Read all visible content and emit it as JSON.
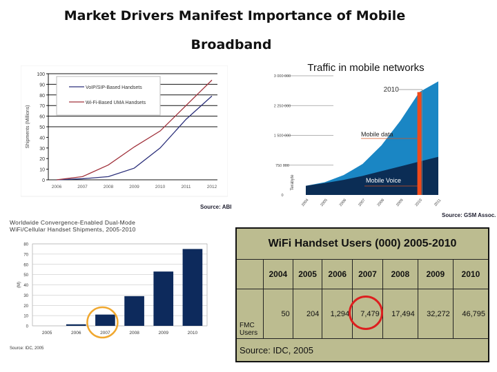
{
  "page": {
    "title_line1": "Market Drivers Manifest Importance of Mobile",
    "title_line2": "Broadband"
  },
  "chart_data": [
    {
      "type": "line",
      "title": "",
      "xlabel": "",
      "ylabel": "Shipments (Millions)",
      "x": [
        "2006",
        "2007",
        "2008",
        "2009",
        "2010",
        "2011",
        "2012"
      ],
      "ylim": [
        0,
        100
      ],
      "yticks": [
        0,
        10,
        20,
        30,
        40,
        50,
        60,
        70,
        80,
        90,
        100
      ],
      "grid": true,
      "legend_position": "top-left",
      "series": [
        {
          "name": "VoIP/SIP-Based Handsets",
          "color": "#2b2f7a",
          "values": [
            0,
            1,
            3,
            11,
            30,
            57,
            79
          ]
        },
        {
          "name": "Wi-Fi-Based UMA Handsets",
          "color": "#a0303a",
          "values": [
            0,
            3,
            14,
            31,
            46,
            70,
            94
          ]
        }
      ],
      "source": "Source: ABI"
    },
    {
      "type": "area",
      "title": "Traffic in mobile networks",
      "xlabel": "",
      "ylabel": "Terabyte",
      "x": [
        "2004",
        "2005",
        "2006",
        "2007",
        "2008",
        "2009",
        "2010",
        "2011"
      ],
      "ylim": [
        0,
        3000000
      ],
      "yticks": [
        "0",
        "750 000",
        "1 500 000",
        "2 250 000",
        "3 000 000"
      ],
      "stacked": true,
      "series": [
        {
          "name": "Mobile Voice",
          "color": "#0b2d55",
          "values": [
            230000,
            300000,
            380000,
            480000,
            600000,
            720000,
            840000,
            960000
          ]
        },
        {
          "name": "Mobile data",
          "color": "#1a86c4",
          "values": [
            0,
            20000,
            120000,
            300000,
            650000,
            1150000,
            1750000,
            1900000
          ]
        }
      ],
      "annotations": [
        {
          "text": "2010",
          "x": "2010"
        },
        {
          "text": "Mobile data"
        },
        {
          "text": "Mobile Voice"
        }
      ],
      "highlight_color": "#f04a1a",
      "source": "Source: GSM Assoc."
    },
    {
      "type": "bar",
      "title": "Worldwide Convergence-Enabled Dual-Mode WiFi/Cellular Handset Shipments, 2005-2010",
      "xlabel": "",
      "ylabel": "(M)",
      "categories": [
        "2005",
        "2006",
        "2007",
        "2008",
        "2009",
        "2010"
      ],
      "values": [
        0,
        1.5,
        11,
        29,
        53,
        75
      ],
      "ylim": [
        0,
        80
      ],
      "yticks": [
        0,
        10,
        20,
        30,
        40,
        50,
        60,
        70,
        80
      ],
      "grid": true,
      "bar_color": "#0d2a5c",
      "highlight": {
        "category": "2007",
        "color": "#f0a830"
      },
      "source": "Source: IDC, 2005"
    },
    {
      "type": "table",
      "title": "WiFi Handset Users (000) 2005-2010",
      "columns": [
        "2004",
        "2005",
        "2006",
        "2007",
        "2008",
        "2009",
        "2010"
      ],
      "rows": [
        {
          "label": "FMC Users",
          "values": [
            "50",
            "204",
            "1,294",
            "7,479",
            "17,494",
            "32,272",
            "46,795"
          ]
        }
      ],
      "highlight": {
        "column": "2007",
        "color": "#dd1f1f"
      },
      "source": "Source: IDC, 2005",
      "background": "#bcbc90"
    }
  ]
}
